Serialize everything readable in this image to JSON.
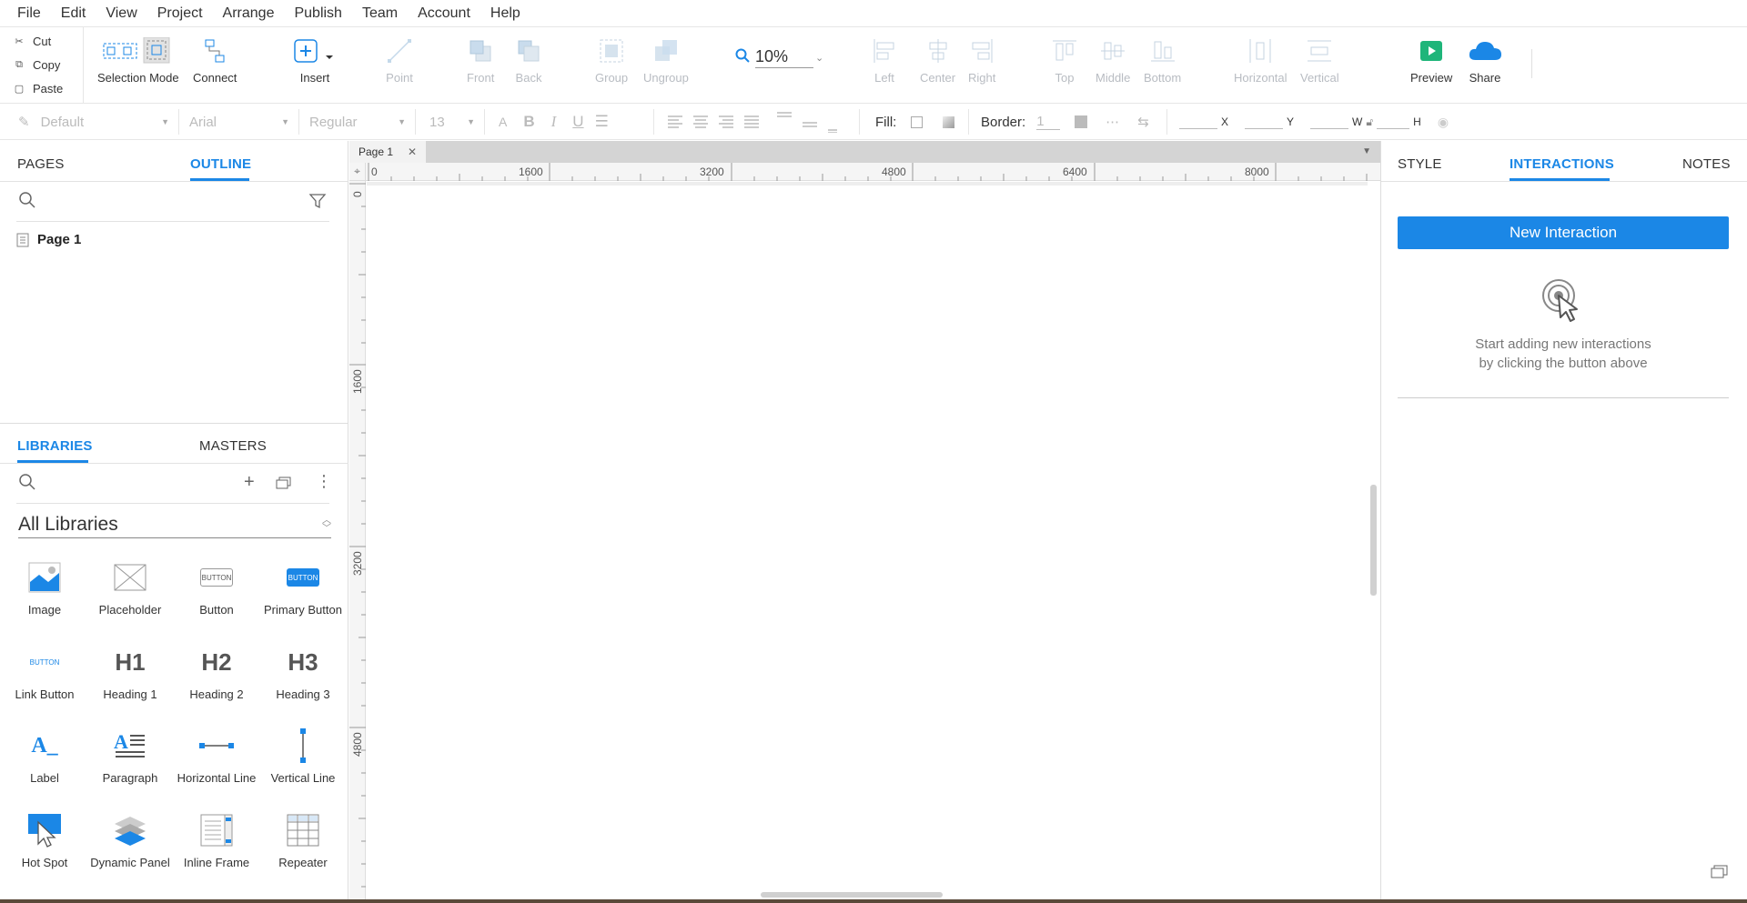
{
  "menubar": {
    "items": [
      "File",
      "Edit",
      "View",
      "Project",
      "Arrange",
      "Publish",
      "Team",
      "Account",
      "Help"
    ]
  },
  "clipboard": {
    "cut": "Cut",
    "copy": "Copy",
    "paste": "Paste"
  },
  "toolbar": {
    "selection_mode": "Selection Mode",
    "connect": "Connect",
    "insert": "Insert",
    "point": "Point",
    "front": "Front",
    "back": "Back",
    "group": "Group",
    "ungroup": "Ungroup",
    "zoom": "10%",
    "left": "Left",
    "center": "Center",
    "right": "Right",
    "top": "Top",
    "middle": "Middle",
    "bottom": "Bottom",
    "horizontal": "Horizontal",
    "vertical": "Vertical",
    "preview": "Preview",
    "share": "Share"
  },
  "formatbar": {
    "style": "Default",
    "font": "Arial",
    "weight": "Regular",
    "size": "13",
    "fill_label": "Fill:",
    "border_label": "Border:",
    "border_value": "1",
    "x_label": "X",
    "y_label": "Y",
    "w_label": "W",
    "h_label": "H"
  },
  "left_panel": {
    "tabs": {
      "pages": "PAGES",
      "outline": "OUTLINE"
    },
    "pages": [
      {
        "name": "Page 1"
      }
    ],
    "lib_tabs": {
      "libraries": "LIBRARIES",
      "masters": "MASTERS"
    },
    "library_select": "All Libraries",
    "widgets": [
      {
        "label": "Image",
        "icon": "image-icon"
      },
      {
        "label": "Placeholder",
        "icon": "placeholder-icon"
      },
      {
        "label": "Button",
        "icon": "button-icon"
      },
      {
        "label": "Primary Button",
        "icon": "primary-button-icon"
      },
      {
        "label": "Link Button",
        "icon": "link-button-icon"
      },
      {
        "label": "Heading 1",
        "icon": "heading1-icon"
      },
      {
        "label": "Heading 2",
        "icon": "heading2-icon"
      },
      {
        "label": "Heading 3",
        "icon": "heading3-icon"
      },
      {
        "label": "Label",
        "icon": "label-icon"
      },
      {
        "label": "Paragraph",
        "icon": "paragraph-icon"
      },
      {
        "label": "Horizontal Line",
        "icon": "horizontal-line-icon"
      },
      {
        "label": "Vertical Line",
        "icon": "vertical-line-icon"
      },
      {
        "label": "Hot Spot",
        "icon": "hot-spot-icon"
      },
      {
        "label": "Dynamic Panel",
        "icon": "dynamic-panel-icon"
      },
      {
        "label": "Inline Frame",
        "icon": "inline-frame-icon"
      },
      {
        "label": "Repeater",
        "icon": "repeater-icon"
      }
    ],
    "widget_glyphs": {
      "button": "BUTTON",
      "primary_button": "BUTTON",
      "link_button": "BUTTON",
      "h1": "H1",
      "h2": "H2",
      "h3": "H3",
      "label": "A_"
    }
  },
  "canvas": {
    "tab_name": "Page 1",
    "h_ruler": [
      "0",
      "1600",
      "3200",
      "4800",
      "6400",
      "8000"
    ],
    "v_ruler": [
      "0",
      "1600",
      "3200",
      "4800"
    ]
  },
  "right_panel": {
    "tabs": {
      "style": "STYLE",
      "interactions": "INTERACTIONS",
      "notes": "NOTES"
    },
    "new_interaction": "New Interaction",
    "empty_line1": "Start adding new interactions",
    "empty_line2": "by clicking the button above"
  },
  "colors": {
    "accent": "#1b87e6",
    "preview_green": "#1fb57a",
    "disabled": "#b8bcc2"
  }
}
